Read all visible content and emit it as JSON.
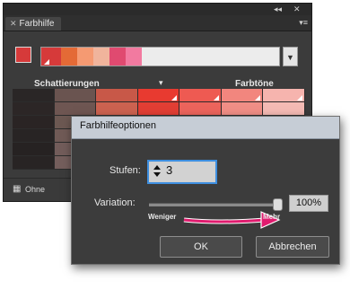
{
  "panel": {
    "title_bar": {
      "collapse_glyph": "◂◂",
      "close_glyph": "✕"
    },
    "tab": {
      "close_glyph": "✕",
      "label": "Farbhilfe"
    },
    "menu_glyph": "▾≡",
    "base_color": "#d63a3a",
    "harmony_colors": [
      "#d63a3a",
      "#e46a36",
      "#f59a72",
      "#f0b49c",
      "#e04a70",
      "#f27aa0",
      "#ececec"
    ],
    "harmony_dropdown_glyph": "▼",
    "header_shades": "Schattierungen",
    "header_arrow": "▾",
    "header_tones": "Farbtöne",
    "grid_colors": [
      [
        "#2a2626",
        "#6a5450",
        "#c85848",
        "#e83a30",
        "#ee5a52",
        "#f2867e",
        "#f6b4ae"
      ],
      [
        "#2c2626",
        "#6e5652",
        "#cc6250",
        "#e23e34",
        "#ec645c",
        "#f08e86",
        "#f4bab4"
      ],
      [
        "#2a2424",
        "#6c5852",
        "#c4685a",
        "#dc4e42",
        "#e87268",
        "#ee9a92",
        "#f2c2bc"
      ],
      [
        "#282424",
        "#705a56",
        "#c27064",
        "#d85e56",
        "#e47e76",
        "#eca29c",
        "#f0c8c4"
      ],
      [
        "#262222",
        "#725c5a",
        "#c0786e",
        "#d46e66",
        "#e08a84",
        "#eaaaa4",
        "#eeccc8"
      ],
      [
        "#282424",
        "#745e5c",
        "#be7e76",
        "#d07a72",
        "#de948e",
        "#e8b2ae",
        "#eed2ce"
      ]
    ],
    "grid_markers": [
      3,
      4,
      5,
      6
    ],
    "footer_icon": "▦",
    "footer_label": "Ohne"
  },
  "dialog": {
    "title": "Farbhilfeoptionen",
    "steps_label": "Stufen:",
    "steps_value": "3",
    "variation_label": "Variation:",
    "variation_value": "100%",
    "variation_level": 1.0,
    "less_label": "Weniger",
    "more_label": "Mehr",
    "arrow_color": "#e01b6e",
    "ok_label": "OK",
    "cancel_label": "Abbrechen"
  }
}
